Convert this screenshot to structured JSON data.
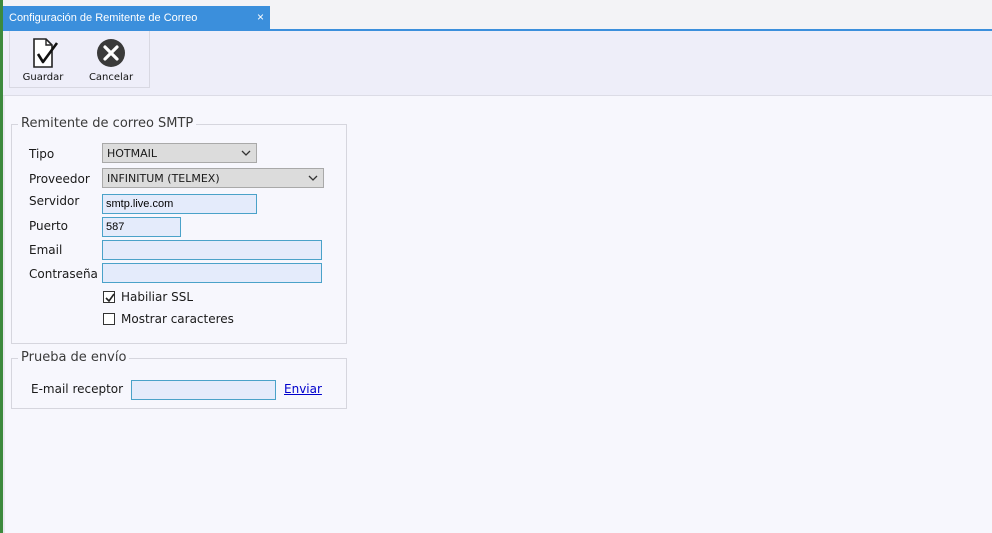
{
  "tab": {
    "title": "Configuración de Remitente de Correo",
    "close": "×"
  },
  "toolbar": {
    "save_label": "Guardar",
    "cancel_label": "Cancelar"
  },
  "smtp": {
    "legend": "Remitente de correo SMTP",
    "tipo_label": "Tipo",
    "tipo_value": "HOTMAIL",
    "proveedor_label": "Proveedor",
    "proveedor_value": "INFINITUM (TELMEX)",
    "servidor_label": "Servidor",
    "servidor_value": "smtp.live.com",
    "puerto_label": "Puerto",
    "puerto_value": "587",
    "email_label": "Email",
    "email_value": "",
    "password_label": "Contraseña",
    "password_value": "",
    "ssl_label": "Habiliar SSL",
    "ssl_checked": true,
    "show_chars_label": "Mostrar caracteres",
    "show_chars_checked": false
  },
  "test": {
    "legend": "Prueba de envío",
    "receptor_label": "E-mail receptor",
    "receptor_value": "",
    "send_link": "Enviar"
  },
  "colors": {
    "tab_blue": "#3b8fdc",
    "input_border": "#4aa2c9",
    "input_bg": "#e4ebfb",
    "link": "#0000cc"
  }
}
